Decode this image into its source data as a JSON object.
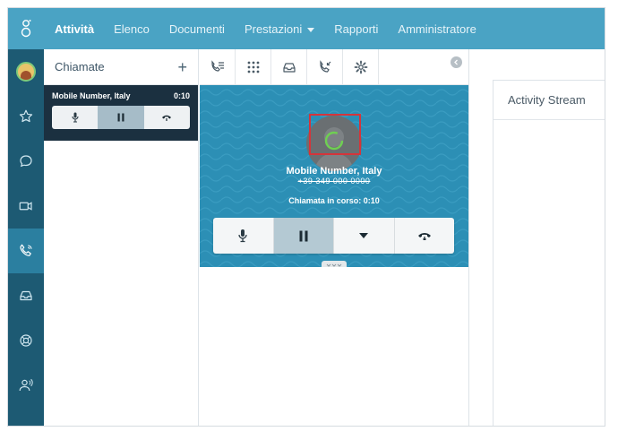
{
  "nav": {
    "items": [
      {
        "label": "Attività",
        "active": true
      },
      {
        "label": "Elenco"
      },
      {
        "label": "Documenti"
      },
      {
        "label": "Prestazioni",
        "dropdown": true
      },
      {
        "label": "Rapporti"
      },
      {
        "label": "Amministratore"
      }
    ]
  },
  "rail": {
    "icons": [
      "avatar",
      "star-icon",
      "chat-icon",
      "video-icon",
      "phone-icon",
      "inbox-icon",
      "support-icon",
      "user-voice-icon"
    ],
    "active": "phone-icon"
  },
  "calls_panel": {
    "title": "Chiamate",
    "add_label": "+",
    "active_call": {
      "name": "Mobile Number, Italy",
      "duration": "0:10"
    }
  },
  "call": {
    "caller_name": "Mobile Number, Italy",
    "caller_number": "+39 349 000 0000",
    "status": "Chiamata in corso: 0:10"
  },
  "activity": {
    "title": "Activity Stream"
  },
  "colors": {
    "topnav": "#4aa3c4",
    "rail": "#1d5a73",
    "rail_active": "#2b7fa0",
    "call_card": "#1b3040",
    "call_pane": "#2c8fb5",
    "highlight_box": "#d5343a"
  }
}
